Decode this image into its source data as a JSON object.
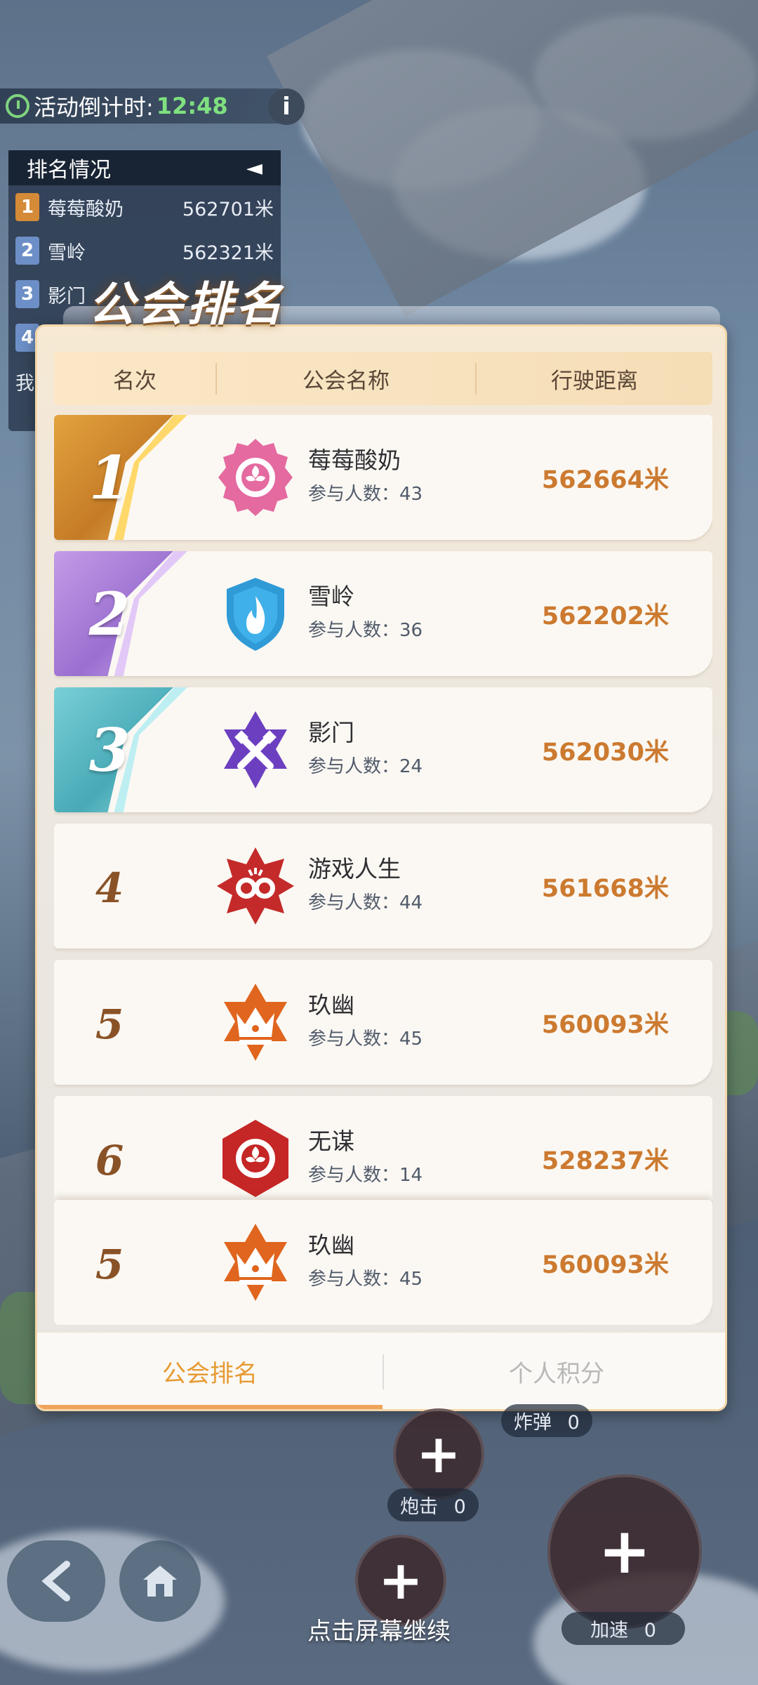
{
  "hud": {
    "timer_label": "活动倒计时:",
    "timer_value": "12:48",
    "info_label": "i"
  },
  "side_ranking": {
    "title": "排名情况",
    "collapse_arrow": "◄",
    "rows": [
      {
        "rank": "1",
        "name": "莓莓酸奶",
        "distance": "562701米"
      },
      {
        "rank": "2",
        "name": "雪岭",
        "distance": "562321米"
      },
      {
        "rank": "3",
        "name": "影门",
        "distance": ""
      },
      {
        "rank": "4",
        "name": "",
        "distance": ""
      },
      {
        "rank": "",
        "name": "我",
        "distance": ""
      }
    ]
  },
  "modal": {
    "title": "公会排名",
    "columns": {
      "rank": "名次",
      "name": "公会名称",
      "distance": "行驶距离"
    },
    "rows": [
      {
        "rank": "1",
        "name": "莓莓酸奶",
        "members": "参与人数：43",
        "distance": "562664米",
        "emblem": "rose-badge-icon",
        "color": "#e46aa0"
      },
      {
        "rank": "2",
        "name": "雪岭",
        "members": "参与人数：36",
        "distance": "562202米",
        "emblem": "flame-shield-icon",
        "color": "#2f9ad6"
      },
      {
        "rank": "3",
        "name": "影门",
        "members": "参与人数：24",
        "distance": "562030米",
        "emblem": "crossed-swords-star-icon",
        "color": "#6c3fc0"
      },
      {
        "rank": "4",
        "name": "游戏人生",
        "members": "参与人数：44",
        "distance": "561668米",
        "emblem": "fist-star-icon",
        "color": "#c42a2a"
      },
      {
        "rank": "5",
        "name": "玖幽",
        "members": "参与人数：45",
        "distance": "560093米",
        "emblem": "crown-star-icon",
        "color": "#e0651e"
      },
      {
        "rank": "6",
        "name": "无谋",
        "members": "参与人数：14",
        "distance": "528237米",
        "emblem": "rose-hexagon-icon",
        "color": "#c52626"
      }
    ],
    "my_row": {
      "rank": "5",
      "name": "玖幽",
      "members": "参与人数：45",
      "distance": "560093米",
      "emblem": "crown-star-icon",
      "color": "#e0651e"
    },
    "tabs": {
      "guild": "公会排名",
      "personal": "个人积分"
    }
  },
  "controls": {
    "bomb_label": "炸弹",
    "bomb_count": "0",
    "cannon_label": "炮击",
    "cannon_count": "0",
    "speed_label": "加速",
    "speed_count": "0",
    "continue": "点击屏幕继续"
  },
  "colors": {
    "accent": "#e69b33",
    "distance": "#cc7a30",
    "gold": "#c57b26",
    "purple": "#9a6fd0",
    "teal": "#47aab6"
  }
}
